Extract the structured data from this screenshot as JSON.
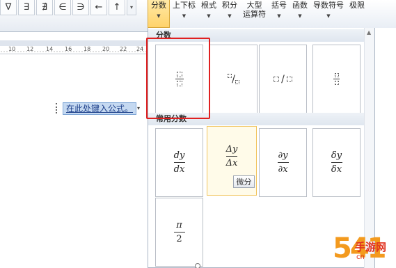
{
  "ribbon_left": {
    "symbols": [
      "∇",
      "∃",
      "∄",
      "∈",
      "∋",
      "←",
      "↑"
    ],
    "more_icon": "scroll-down-icon"
  },
  "ruler": {
    "labels": [
      "10",
      "12",
      "14",
      "16",
      "18",
      "20",
      "22",
      "24"
    ]
  },
  "document": {
    "equation_placeholder": "在此处键入公式。"
  },
  "ribbon_right": {
    "tabs": [
      {
        "label": "分数",
        "label2": "",
        "active": true
      },
      {
        "label": "上下标",
        "label2": "",
        "active": false
      },
      {
        "label": "根式",
        "label2": "",
        "active": false
      },
      {
        "label": "积分",
        "label2": "",
        "active": false
      },
      {
        "label": "大型",
        "label2": "运算符",
        "active": false
      },
      {
        "label": "括号",
        "label2": "",
        "active": false
      },
      {
        "label": "函数",
        "label2": "",
        "active": false
      },
      {
        "label": "导数符号",
        "label2": "",
        "active": false
      },
      {
        "label": "极限",
        "label2": "",
        "active": false
      }
    ]
  },
  "gallery": {
    "section_fraction": "分数",
    "section_common": "常用分数",
    "tooltip": "微分",
    "common": {
      "dy_num": "dy",
      "dy_den": "dx",
      "delta_num": "Δy",
      "delta_den": "Δx",
      "partial_num": "∂y",
      "partial_den": "∂x",
      "small_delta_num": "δy",
      "small_delta_den": "δx",
      "pi_num": "π",
      "pi_den": "2"
    },
    "slash": "/"
  },
  "watermark": {
    "number": "54",
    "number2": "1",
    "text": "手游网",
    "url": "cn"
  }
}
